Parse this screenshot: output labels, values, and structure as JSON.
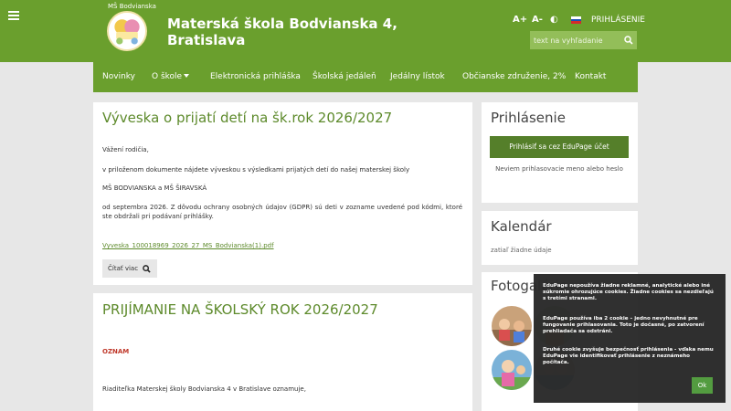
{
  "header": {
    "logo_caption": "MŠ Bodvianska",
    "site_title": "Materská škola Bodvianska 4, Bratislava",
    "font_larger": "A+",
    "font_smaller": "A-",
    "contrast": "◐",
    "login": "PRIHLÁSENIE",
    "search_placeholder": "text na vyhľadanie"
  },
  "nav": {
    "items": [
      "Novinky",
      "O škole",
      "Elektronická prihláška",
      "Školská jedáleň",
      "Jedálny lístok",
      "Občianske združenie, 2%",
      "Kontakt"
    ]
  },
  "articles": [
    {
      "title": "Výveska o prijatí detí na šk.rok 2026/2027",
      "paragraphs": [
        "Vážení rodičia,",
        "v priloženom dokumente nájdete výveskou s výsledkami prijatých detí do našej materskej školy",
        "MŠ BODVIANSKA a MŠ ŠIRAVSKÁ",
        "od septembra 2026. Z dôvodu ochrany osobných údajov (GDPR) sú deti v zozname uvedené pod kódmi, ktoré ste obdržali pri podávaní prihlášky."
      ],
      "attachment": "Vyveska_100018969_2026_27_MS_Bodvianska(1).pdf",
      "read_more": "Čítať viac"
    },
    {
      "title": "PRIJÍMANIE NA ŠKOLSKÝ ROK 2026/2027",
      "label": "OZNAM",
      "paragraph": "Riaditeľka Materskej školy Bodvianska 4 v Bratislave oznamuje,"
    }
  ],
  "sidebar": {
    "login": {
      "title": "Prihlásenie",
      "button": "Prihlásiť sa cez EduPage účet",
      "forgot": "Neviem prihlasovacie meno alebo heslo"
    },
    "calendar": {
      "title": "Kalendár",
      "empty": "zatiaľ žiadne údaje"
    },
    "gallery": {
      "title": "Fotogalérie"
    }
  },
  "cookie": {
    "p1": "EduPage nepoužíva žiadne reklamné, analytické alebo iné súkromie ohrozujúce cookies. Žiadne cookies sa nezdieľajú s tretími stranami.",
    "p2": "EduPage používa iba 2 cookie – jedno nevyhnutné pre fungovanie prihlasovania. Toto je dočasné, po zatvorení prehliadača sa odstráni.",
    "p3": "Druhé cookie zvyšuje bezpečnosť prihlásenia - vďaka nemu EduPage vie identifikovať prihlásenie z neznámeho počítača.",
    "ok": "Ok"
  },
  "colors": {
    "brand_green": "#6a9f2d",
    "button_green": "#557f2a",
    "accent_red": "#c0392b"
  }
}
